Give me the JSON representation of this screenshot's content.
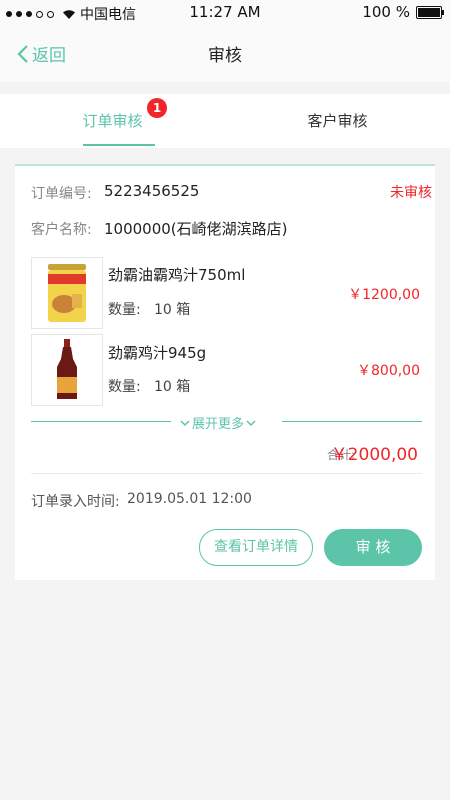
{
  "status_bar": {
    "carrier": "中国电信",
    "time": "11:27 AM",
    "battery": "100 %"
  },
  "nav": {
    "back_label": "返回",
    "title": "审核"
  },
  "tabs": [
    {
      "label": "订单审核",
      "badge": "1",
      "active": true
    },
    {
      "label": "客户审核",
      "active": false
    }
  ],
  "order": {
    "number_label": "订单编号:",
    "number": "5223456525",
    "status": "未审核",
    "customer_label": "客户名称:",
    "customer": "1000000(石崎佬湖滨路店)",
    "items": [
      {
        "name": "劲霸油霸鸡汁750ml",
        "qty_label": "数量:",
        "qty": "10 箱",
        "price": "￥1200,00"
      },
      {
        "name": "劲霸鸡汁945g",
        "qty_label": "数量:",
        "qty": "10 箱",
        "price": "￥800,00"
      }
    ],
    "expand_label": "展开更多",
    "total_label": "合计:",
    "total": "￥2000,00",
    "time_label": "订单录入时间:",
    "time": "2019.05.01  12:00",
    "details_button": "查看订单详情",
    "approve_button": "审 核"
  },
  "colors": {
    "accent": "#5cc4a8",
    "alert": "#f0262b"
  }
}
